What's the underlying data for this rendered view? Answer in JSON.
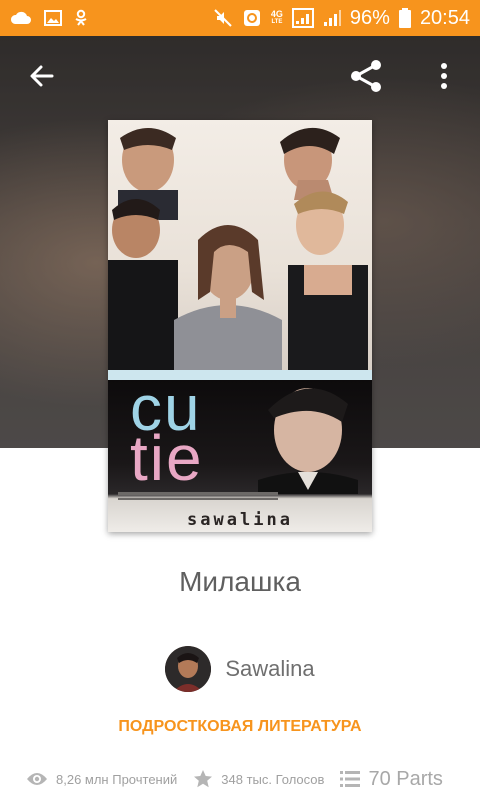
{
  "status_bar": {
    "signal_label_top": "4G",
    "signal_label_bottom": "LTE",
    "battery": "96%",
    "time": "20:54"
  },
  "icons": {
    "back": "arrow-left-icon",
    "share": "share-icon",
    "more": "more-vertical-icon",
    "reads": "eye-icon",
    "votes": "star-icon",
    "parts": "list-icon"
  },
  "cover": {
    "title_line1": "cu",
    "title_line2": "tie",
    "author": "sawalina"
  },
  "story": {
    "title": "Милашка",
    "author": "Sawalina",
    "genre": "ПОДРОСТКОВАЯ ЛИТЕРАТУРА"
  },
  "stats": {
    "reads": "8,26 млн Прочтений",
    "votes": "348 тыс. Голосов",
    "parts": "70 Parts"
  },
  "colors": {
    "accent": "#f7941d",
    "title_text": "#5f5f5f",
    "stats_text": "#a0a0a0"
  }
}
